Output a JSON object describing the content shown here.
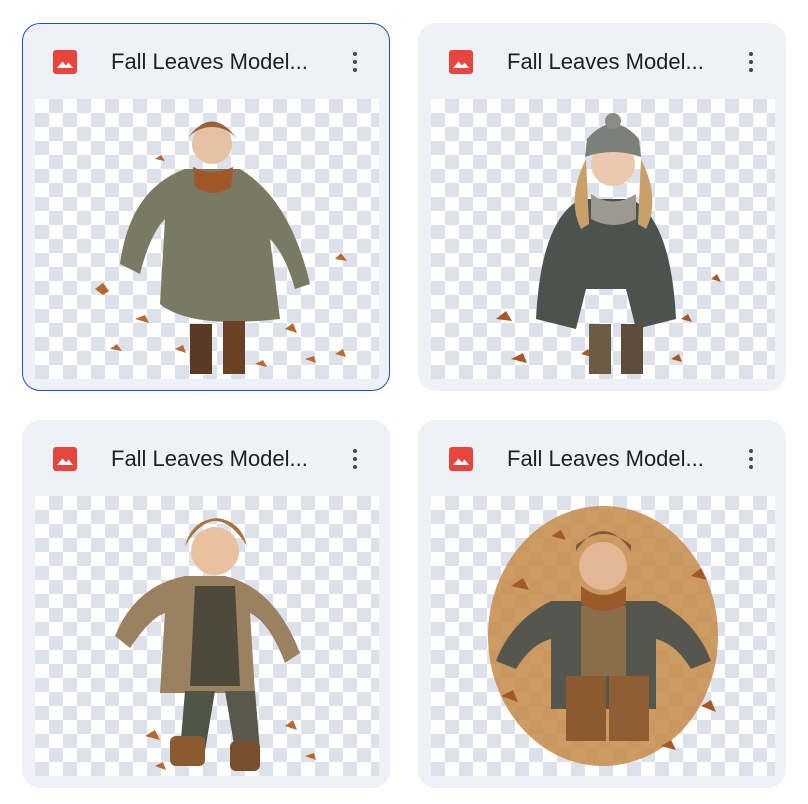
{
  "files": [
    {
      "title": "Fall Leaves Model...",
      "icon": "image-file-icon",
      "selected": true
    },
    {
      "title": "Fall Leaves Model...",
      "icon": "image-file-icon",
      "selected": false
    },
    {
      "title": "Fall Leaves Model...",
      "icon": "image-file-icon",
      "selected": false
    },
    {
      "title": "Fall Leaves Model...",
      "icon": "image-file-icon",
      "selected": false
    }
  ],
  "colors": {
    "icon_red": "#e8453c",
    "selected_border": "#1a56c9",
    "card_bg": "#eef1f6"
  }
}
